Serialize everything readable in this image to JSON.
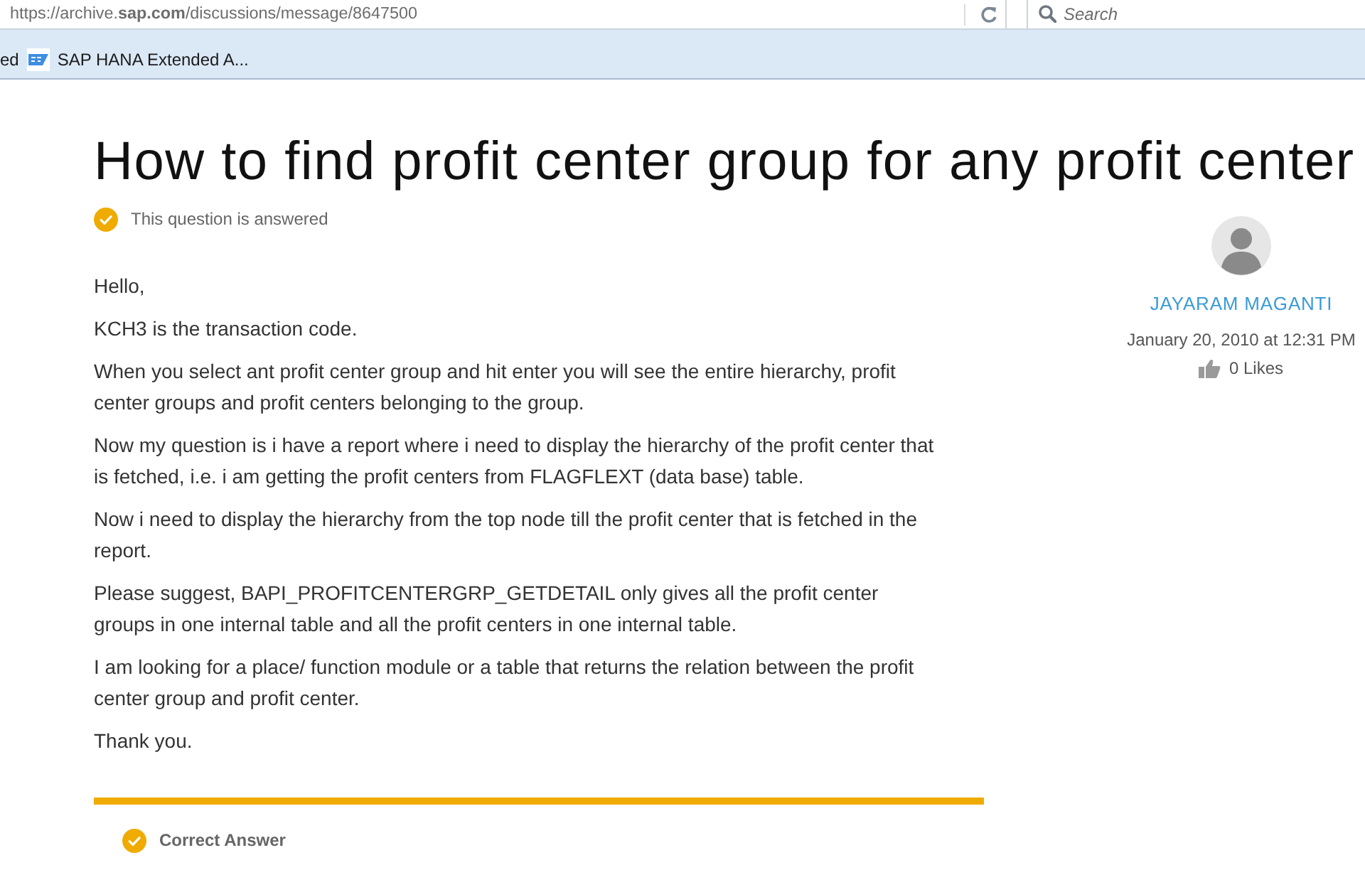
{
  "browser": {
    "url": "https://archive.**sap.com**/discussions/message/8647500",
    "search": {
      "placeholder": "Search"
    }
  },
  "bookmarks": [
    {
      "kind": "plain",
      "label": "ed"
    },
    {
      "kind": "favicon",
      "label": "SAP HANA Extended A..."
    }
  ],
  "question": {
    "title": "How to find profit center group for any profit center",
    "status": "This question is answered",
    "paragraphs": [
      "Hello,",
      "KCH3 is the transaction code.",
      "When you select ant profit center group and hit enter you will see the entire hierarchy, profit center groups and profit centers belonging to the group.",
      "Now my question is i have a report where i need to display the hierarchy of the profit center that is fetched, i.e. i am getting the profit centers from FLAGFLEXT (data base) table.",
      "Now i need to display the hierarchy from the top node till the profit center that is fetched in the report.",
      "Please suggest, BAPI_PROFITCENTERGRP_GETDETAIL only gives all the profit center groups in one internal table and all the profit centers in one internal table.",
      "I am looking for a place/ function module or a table that returns the relation between the profit center group and profit center.",
      "Thank you."
    ]
  },
  "author": {
    "name": "JAYARAM MAGANTI",
    "date": "January 20, 2010 at 12:31 PM",
    "likes": "0 Likes"
  },
  "correct_answer": {
    "label": "Correct Answer"
  }
}
